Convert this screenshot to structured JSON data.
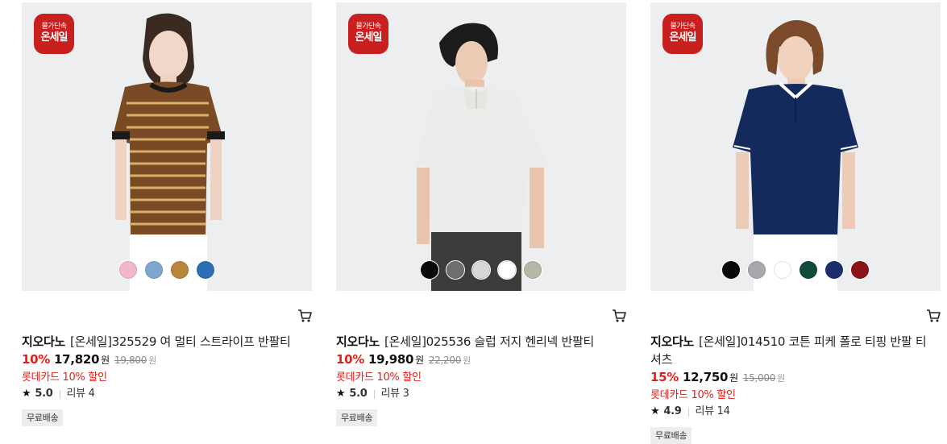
{
  "products": [
    {
      "badge_top": "물가단속",
      "badge_bottom": "온세일",
      "brand": "지오다노",
      "name": "[온세일]325529 여 멀티 스트라이프 반팔티",
      "discount": "10%",
      "price": "17,820",
      "price_unit": "원",
      "original_price": "19,800",
      "original_unit": "원",
      "card_discount": "롯데카드 10% 할인",
      "rating": "5.0",
      "review": "리뷰 4",
      "shipping": "무료배송",
      "swatch_colors": [
        "#f2b8c8",
        "#7fa6d0",
        "#b8863a",
        "#2d6fb5"
      ]
    },
    {
      "badge_top": "물가단속",
      "badge_bottom": "온세일",
      "brand": "지오다노",
      "name": "[온세일]025536 슬럽 저지 헨리넥 반팔티",
      "discount": "10%",
      "price": "19,980",
      "price_unit": "원",
      "original_price": "22,200",
      "original_unit": "원",
      "card_discount": "롯데카드 10% 할인",
      "rating": "5.0",
      "review": "리뷰 3",
      "shipping": "무료배송",
      "swatch_colors": [
        "#0a0a0a",
        "#6e6e6e",
        "#d7d7d7",
        "#ffffff",
        "#b6b7a6"
      ]
    },
    {
      "badge_top": "물가단속",
      "badge_bottom": "온세일",
      "brand": "지오다노",
      "name": "[온세일]014510 코튼 피케 폴로 티핑 반팔 티셔츠",
      "discount": "15%",
      "price": "12,750",
      "price_unit": "원",
      "original_price": "15,000",
      "original_unit": "원",
      "card_discount": "롯데카드 10% 할인",
      "rating": "4.9",
      "review": "리뷰 14",
      "shipping": "무료배송",
      "swatch_colors": [
        "#0a0a0a",
        "#a8a9ad",
        "#ffffff",
        "#0f4a3a",
        "#1b2f6e",
        "#8c1414"
      ]
    }
  ],
  "icons": {
    "cart": "cart-icon",
    "star": "star-icon"
  }
}
